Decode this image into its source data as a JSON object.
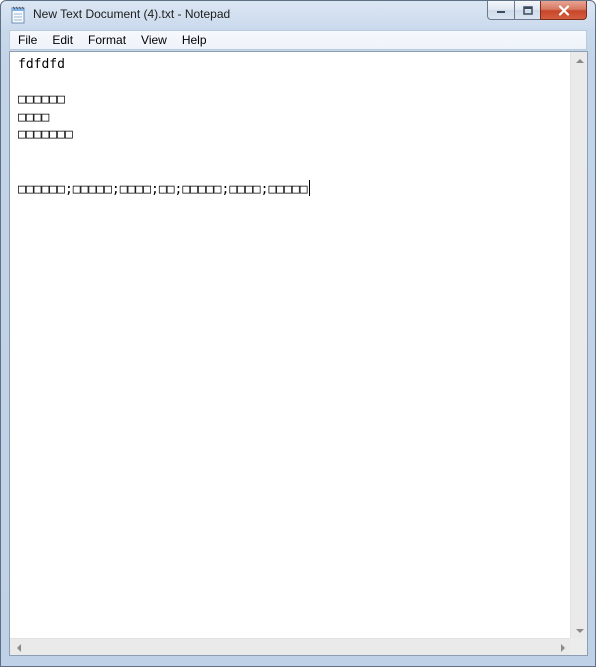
{
  "window": {
    "title": "New Text Document (4).txt - Notepad",
    "app_icon": "notepad-icon",
    "controls": {
      "minimize_icon": "minimize-icon",
      "maximize_icon": "maximize-icon",
      "close_icon": "close-icon"
    }
  },
  "menubar": {
    "items": [
      {
        "label": "File"
      },
      {
        "label": "Edit"
      },
      {
        "label": "Format"
      },
      {
        "label": "View"
      },
      {
        "label": "Help"
      }
    ]
  },
  "editor": {
    "lines": [
      "fdfdfd",
      "",
      "□□□□□□",
      "□□□□",
      "□□□□□□□",
      "",
      "",
      "□□□□□□;□□□□□;□□□□;□□;□□□□□;□□□□;□□□□□"
    ]
  },
  "colors": {
    "frame": "#c3d4e8",
    "close_button": "#c7462b",
    "text": "#000000"
  }
}
